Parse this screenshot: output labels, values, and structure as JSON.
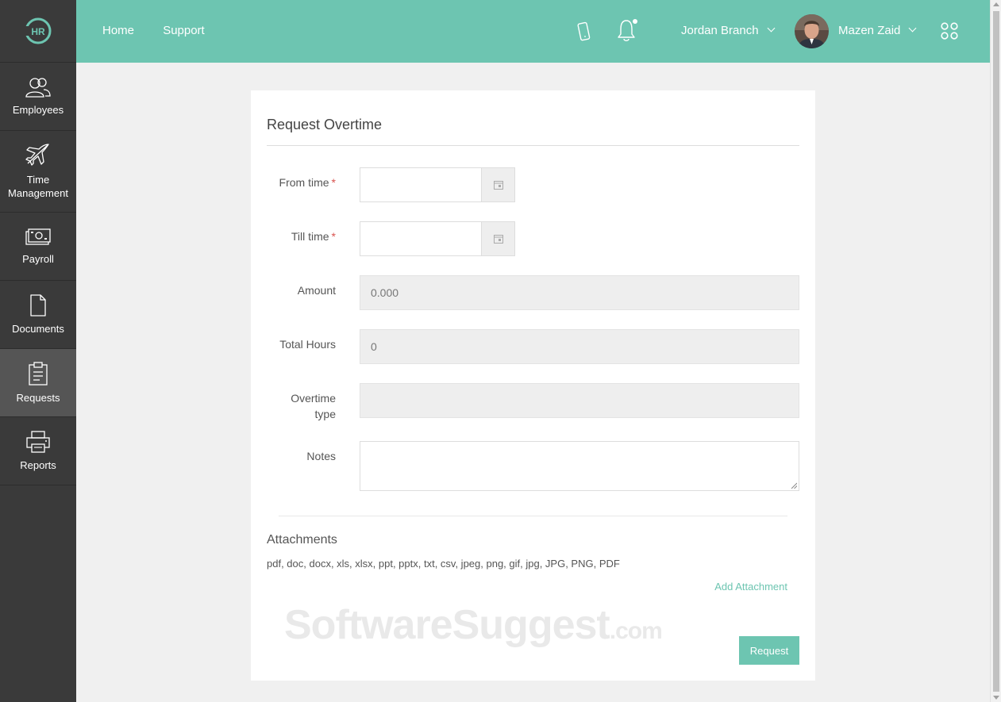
{
  "logo": {
    "text": "HR"
  },
  "sidebar": {
    "items": [
      {
        "label": "Employees",
        "icon": "users-icon"
      },
      {
        "label": "Time Management",
        "icon": "airplane-icon"
      },
      {
        "label": "Payroll",
        "icon": "money-icon"
      },
      {
        "label": "Documents",
        "icon": "document-icon"
      },
      {
        "label": "Requests",
        "icon": "clipboard-icon",
        "active": true
      },
      {
        "label": "Reports",
        "icon": "printer-icon"
      }
    ]
  },
  "topbar": {
    "nav": [
      "Home",
      "Support"
    ],
    "company": "Jordan Branch",
    "user": "Mazen Zaid",
    "accent": "#6dc5b1"
  },
  "form": {
    "title": "Request Overtime",
    "from_time_label": "From time",
    "till_time_label": "Till time",
    "required_mark": "*",
    "amount_label": "Amount",
    "amount_value": "0.000",
    "total_hours_label": "Total Hours",
    "total_hours_value": "0",
    "overtime_type_label": "Overtime type",
    "overtime_type_value": "",
    "notes_label": "Notes",
    "attachments_title": "Attachments",
    "attachment_types": "pdf, doc, docx, xls, xlsx, ppt, pptx, txt, csv, jpeg, png, gif, jpg, JPG, PNG, PDF",
    "add_attachment": "Add Attachment",
    "request_button": "Request"
  },
  "watermark": {
    "main": "SoftwareSuggest",
    "suffix": ".com"
  }
}
